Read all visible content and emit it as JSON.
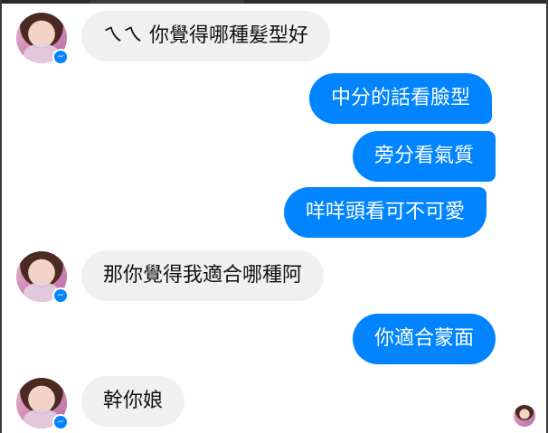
{
  "messages": [
    {
      "side": "in",
      "text": "ㄟㄟ 你覺得哪種髮型好"
    },
    {
      "side": "out",
      "text": "中分的話看臉型"
    },
    {
      "side": "out",
      "text": "旁分看氣質"
    },
    {
      "side": "out",
      "text": "咩咩頭看可不可愛"
    },
    {
      "side": "in",
      "text": "那你覺得我適合哪種阿"
    },
    {
      "side": "out",
      "text": "你適合蒙面"
    },
    {
      "side": "in",
      "text": "幹你娘"
    }
  ],
  "colors": {
    "outgoing_bubble": "#0084ff",
    "incoming_bubble": "#f1f0f0",
    "messenger_badge": "#0084ff"
  },
  "icons": {
    "contact_avatar": "avatar",
    "messenger_badge": "messenger-icon",
    "read_receipt": "read-receipt-avatar"
  }
}
